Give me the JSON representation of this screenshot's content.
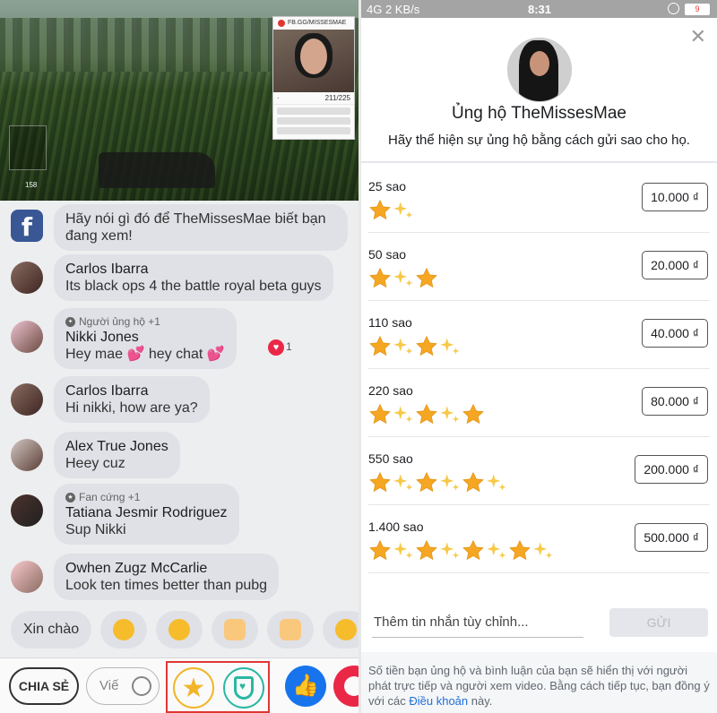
{
  "video_overlay": {
    "channel": "FB.GG/MISSESMAE",
    "ammo": "211/225",
    "hud_count": "158"
  },
  "chat": {
    "system_message": "Hãy nói gì đó để TheMissesMae biết bạn đang xem!",
    "messages": [
      {
        "name": "Carlos Ibarra",
        "text": "Its black ops 4 the battle royal beta guys",
        "badge": ""
      },
      {
        "name": "Nikki Jones",
        "text_a": "Hey mae",
        "text_b": "hey chat",
        "badge": "Người ủng hộ +1",
        "reaction_count": "1"
      },
      {
        "name": "Carlos Ibarra",
        "text": "Hi nikki, how are ya?",
        "badge": ""
      },
      {
        "name": "Alex True Jones",
        "text": "Heey cuz",
        "badge": ""
      },
      {
        "name": "Tatiana Jesmir Rodriguez",
        "text": "Sup Nikki",
        "badge": "Fan cứng +1"
      },
      {
        "name": "Owhen Zugz McCarlie",
        "text": "Look ten times better than pubg",
        "badge": ""
      }
    ]
  },
  "quick_replies": {
    "greeting": "Xin chào",
    "emojis": [
      "laughing-emoji",
      "heart-eyes-emoji",
      "clapping-emoji",
      "thumbs-up-emoji",
      "tears-of-joy-emoji"
    ]
  },
  "bottom_bar": {
    "share_label": "CHIA SẺ",
    "comment_placeholder": "Viế",
    "icons": [
      "star-icon",
      "supporter-badge-icon",
      "like-icon",
      "love-icon"
    ]
  },
  "status_bar": {
    "signal": "4G",
    "speed": "2 KB/s",
    "time": "8:31",
    "battery": "9"
  },
  "stars_dialog": {
    "title": "Ủng hộ TheMissesMae",
    "subtitle": "Hãy thể hiện sự ủng hộ bằng cách gửi sao cho họ.",
    "packs": [
      {
        "label": "25 sao",
        "price": "10.000 ₫",
        "star_icons": 2
      },
      {
        "label": "50 sao",
        "price": "20.000 ₫",
        "star_icons": 3
      },
      {
        "label": "110 sao",
        "price": "40.000 ₫",
        "star_icons": 4
      },
      {
        "label": "220 sao",
        "price": "80.000 ₫",
        "star_icons": 5
      },
      {
        "label": "550 sao",
        "price": "200.000 ₫",
        "star_icons": 6
      },
      {
        "label": "1.400 sao",
        "price": "500.000 ₫",
        "star_icons": 8
      }
    ],
    "message_placeholder": "Thêm tin nhắn tùy chỉnh...",
    "send_label": "GỬI",
    "footer_text": "Số tiền bạn ủng hộ và bình luận của bạn sẽ hiển thị với người phát trực tiếp và người xem video. Bằng cách tiếp tục, bạn đồng ý với các ",
    "footer_link": "Điều khoản",
    "footer_end": " này."
  },
  "colors": {
    "star_gold": "#f7b928",
    "teal": "#2abba7",
    "facebook_blue": "#1877f2",
    "highlight_red": "#e53935"
  }
}
